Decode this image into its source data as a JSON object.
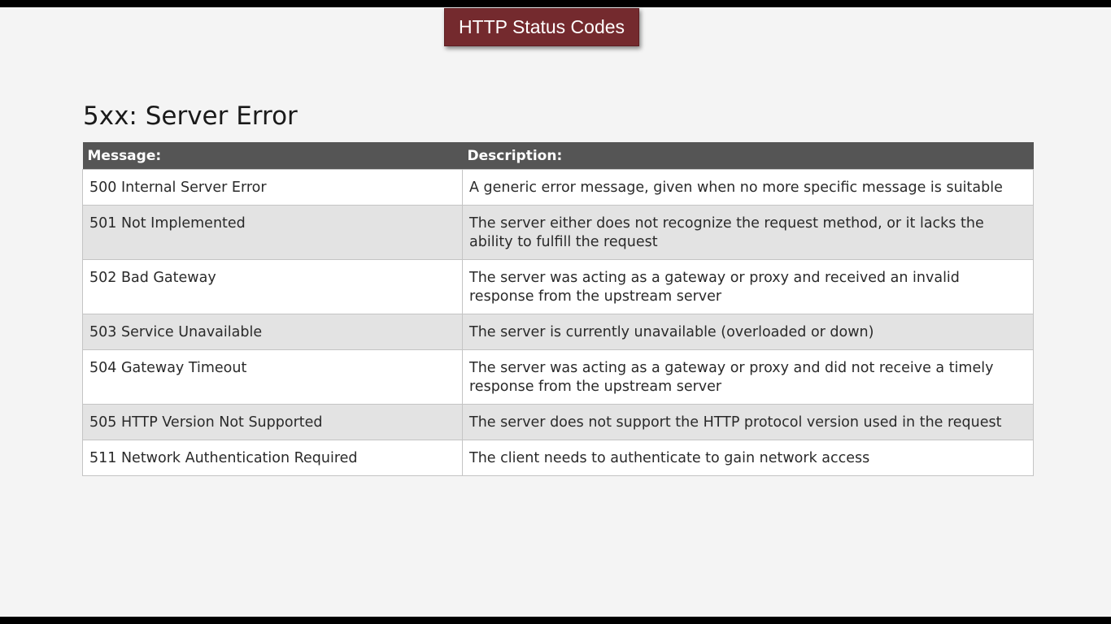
{
  "banner": {
    "title": "HTTP Status Codes"
  },
  "section": {
    "heading": "5xx: Server Error"
  },
  "table": {
    "headers": {
      "message": "Message:",
      "description": "Description:"
    },
    "rows": [
      {
        "message": "500 Internal Server Error",
        "description": "A generic error message, given when no more specific message is suitable"
      },
      {
        "message": "501 Not Implemented",
        "description": "The server either does not recognize the request method, or it lacks the ability to fulfill the request"
      },
      {
        "message": "502 Bad Gateway",
        "description": "The server was acting as a gateway or proxy and received an invalid response from the upstream server"
      },
      {
        "message": "503 Service Unavailable",
        "description": "The server is currently unavailable (overloaded or down)"
      },
      {
        "message": "504 Gateway Timeout",
        "description": "The server was acting as a gateway or proxy and did not receive a timely response from the upstream server"
      },
      {
        "message": "505 HTTP Version Not Supported",
        "description": "The server does not support the HTTP protocol version used in the request"
      },
      {
        "message": "511 Network Authentication Required",
        "description": "The client needs to authenticate to gain network access"
      }
    ]
  },
  "colors": {
    "banner_background": "#742a2e",
    "header_background": "#555555",
    "alternate_row": "#e3e3e3",
    "page_background": "#f4f4f4",
    "letterbox": "#000000"
  }
}
